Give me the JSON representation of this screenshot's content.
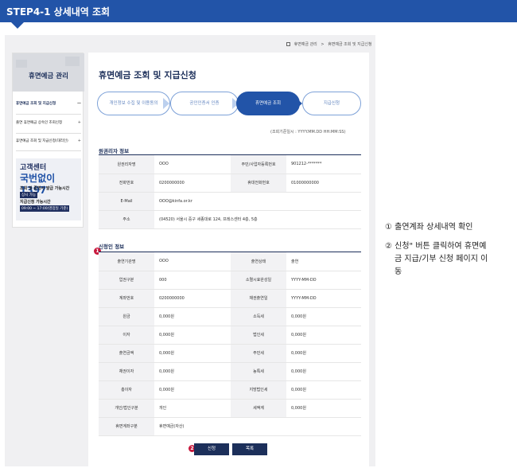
{
  "banner": {
    "title": "STEP4-1 상세내역 조회"
  },
  "breadcrumb": {
    "items": [
      "휴면예금 관리",
      "휴면예금 조회 및 지급신청"
    ]
  },
  "sidebar": {
    "title": "휴면예금 관리",
    "items": [
      {
        "label": "휴면예금 조회 및 지급신청",
        "toggle": "—"
      },
      {
        "label": "출연 휴면예금 상속인 조회신청",
        "toggle": "+"
      },
      {
        "label": "휴면예금 조회 및 지급신청(대리인)",
        "toggle": "+"
      }
    ],
    "contact": {
      "title": "고객센터",
      "phone": "국번없이 1397",
      "hours1_label": "조회 및 증명서 발급 가능시간",
      "hours1_value": "상시 가능",
      "hours2_label": "지급신청 가능시간",
      "hours2_value": "09:00 ~ 17:00(영업일 기준)"
    }
  },
  "main": {
    "title": "휴면예금 조회 및 지급신청",
    "steps": [
      "개인정보 수집 및 이용동의",
      "공인인증서 인증",
      "휴면예금 조회",
      "지급신청"
    ],
    "active_step": 2,
    "reference_time": "(조회기준일시 : YYYY.MM.DD HH:MM:SS)",
    "owner_section": {
      "title": "원권리자 정보",
      "rows": [
        {
          "l1": "원권리자명",
          "v1": "OOO",
          "l2": "주민/사업자등록번호",
          "v2": "901212-*******"
        },
        {
          "l1": "전화번호",
          "v1": "0200000000",
          "l2": "휴대전화번호",
          "v2": "01000000000"
        },
        {
          "l1": "E-Mail",
          "v1": "OOO@kinfa.or.kr"
        },
        {
          "l1": "주소",
          "v1": "(04520) 서울시 중구 세종대로 124, 프레스센터 4층, 5층"
        }
      ]
    },
    "claim_section": {
      "title": "신청인 정보",
      "rows": [
        {
          "l1": "출연기관명",
          "v1": "OOO",
          "l2": "출연상태",
          "v2": "출연"
        },
        {
          "l1": "업권구분",
          "v1": "000",
          "l2": "소멸시효완성일",
          "v2": "YYYY-MM-DD"
        },
        {
          "l1": "계좌번호",
          "v1": "0200000000",
          "l2": "채권출연일",
          "v2": "YYYY-MM-DD"
        },
        {
          "l1": "원금",
          "v1": "0,000원",
          "l2": "소득세",
          "v2": "0,000원"
        },
        {
          "l1": "이자",
          "v1": "0,000원",
          "l2": "법인세",
          "v2": "0,000원"
        },
        {
          "l1": "출연금액",
          "v1": "0,000원",
          "l2": "주민세",
          "v2": "0,000원"
        },
        {
          "l1": "채권이자",
          "v1": "0,000원",
          "l2": "농특세",
          "v2": "0,000원"
        },
        {
          "l1": "총이자",
          "v1": "0,000원",
          "l2": "지방법인세",
          "v2": "0,000원"
        },
        {
          "l1": "개인/법인구분",
          "v1": "개인",
          "l2": "세액계",
          "v2": "0,000원"
        },
        {
          "l1": "휴면계좌구분",
          "v1": "휴면예금(자산)"
        }
      ]
    },
    "buttons": {
      "apply": "신청",
      "list": "목록"
    }
  },
  "markers": {
    "one": "1",
    "two": "2"
  },
  "notes": {
    "note1": "① 출연계좌 상세내역 확인",
    "note2_l1": "② 신청\" 버튼 클릭하여 휴면예",
    "note2_l2": "금 지급/기부 신청 페이지 이",
    "note2_l3": "동"
  }
}
